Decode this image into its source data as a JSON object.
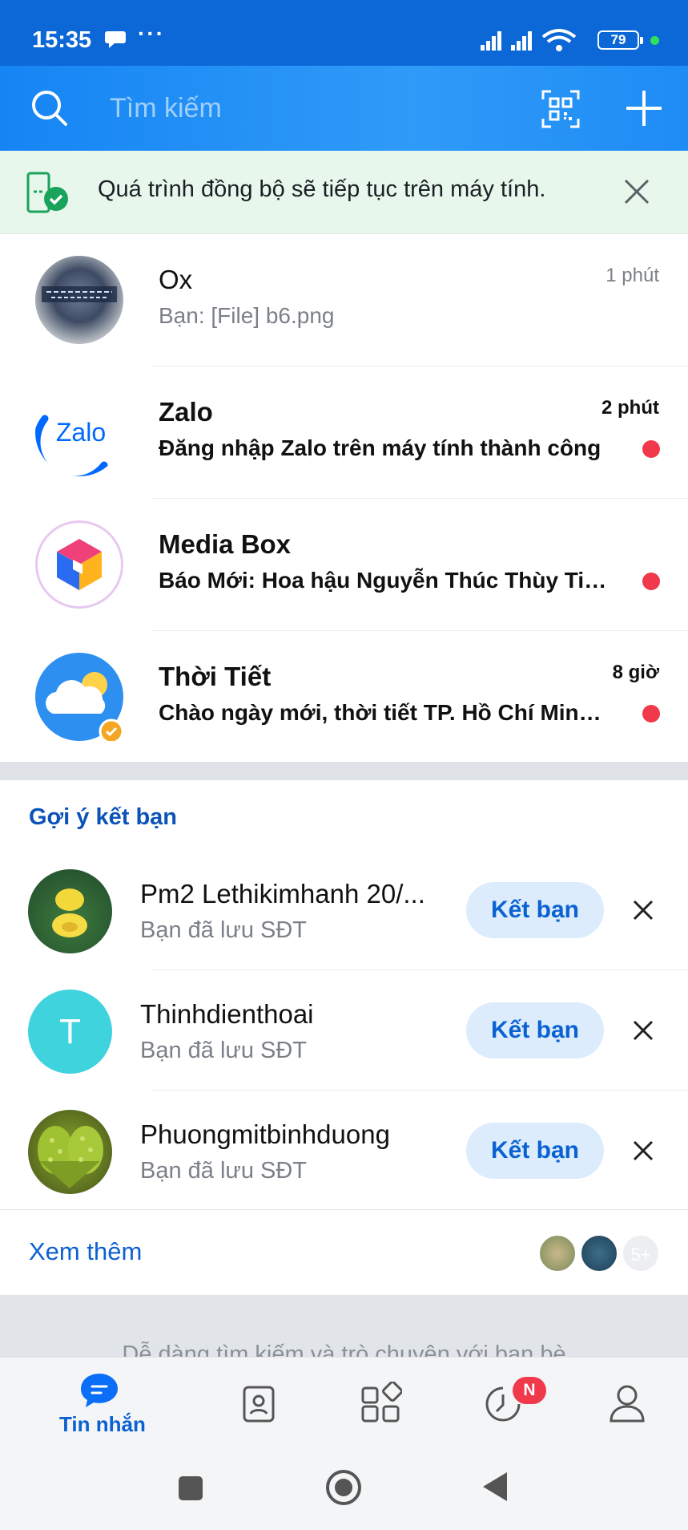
{
  "status_bar": {
    "time": "15:35",
    "more": "···",
    "battery": "79"
  },
  "header": {
    "search_placeholder": "Tìm kiếm"
  },
  "sync_banner": {
    "text": "Quá trình đồng bộ sẽ tiếp tục trên máy tính."
  },
  "chats": [
    {
      "name": "Ox",
      "message": "Bạn: [File] b6.png",
      "time": "1 phút",
      "unread": false
    },
    {
      "name": "Zalo",
      "message": "Đăng nhập Zalo trên máy tính thành công",
      "time": "2 phút",
      "unread": true
    },
    {
      "name": "Media Box",
      "message": "Báo Mới: Hoa hậu Nguyễn Thúc Thùy Tiên...",
      "time": "",
      "unread": true
    },
    {
      "name": "Thời Tiết",
      "message": "Chào ngày mới, thời tiết TP. Hồ Chí Minh...",
      "time": "8 giờ",
      "unread": true
    }
  ],
  "suggestions": {
    "title": "Gợi ý kết bạn",
    "items": [
      {
        "name": "Pm2 Lethikimhanh 20/...",
        "subtitle": "Bạn đã lưu SĐT",
        "button": "Kết bạn",
        "initial": ""
      },
      {
        "name": "Thinhdienthoai",
        "subtitle": "Bạn đã lưu SĐT",
        "button": "Kết bạn",
        "initial": "T"
      },
      {
        "name": "Phuongmitbinhduong",
        "subtitle": "Bạn đã lưu SĐT",
        "button": "Kết bạn",
        "initial": ""
      }
    ],
    "see_more": "Xem thêm",
    "more_count": "5+"
  },
  "hint": "Dễ dàng tìm kiếm và trò chuyện với bạn bè",
  "bottom_nav": {
    "messages_label": "Tin nhắn",
    "timeline_badge": "N"
  },
  "zalo_logo_text": "Zalo",
  "colors": {
    "accent": "#1685f4",
    "unread": "#f0394a",
    "sync_bg": "#e7f7ec",
    "button_bg": "#dcecfd"
  }
}
